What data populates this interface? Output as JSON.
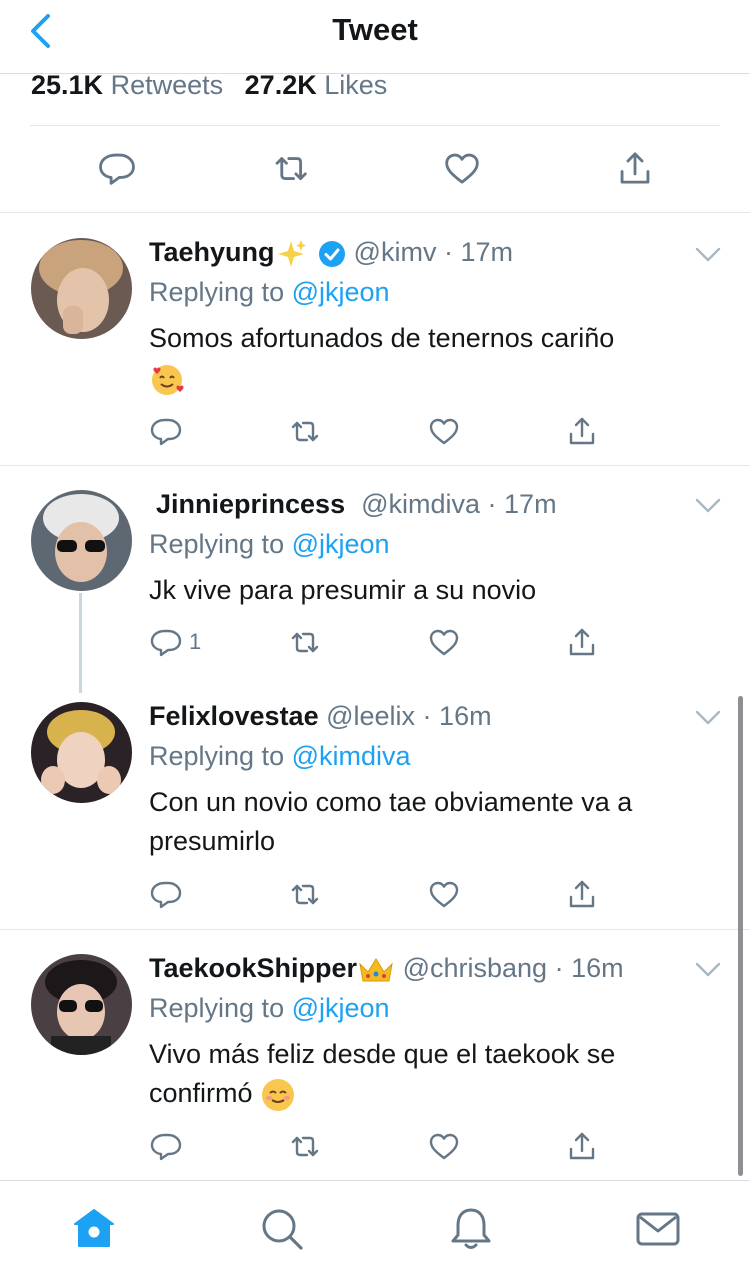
{
  "header": {
    "title": "Tweet"
  },
  "stats": {
    "retweets_count": "25.1K",
    "retweets_label": "Retweets",
    "likes_count": "27.2K",
    "likes_label": "Likes"
  },
  "colors": {
    "accent": "#1da1f2",
    "secondary_text": "#657786",
    "divider": "#e1e8ed"
  },
  "tweets": [
    {
      "name": "Taehyung",
      "name_emoji": "sparkles",
      "verified": true,
      "handle": "@kimv",
      "time": "17m",
      "replying_prefix": "Replying to",
      "replying_to": "@jkjeon",
      "text": "Somos afortunados de tenernos cariño",
      "text_emoji": "smiling-face-with-hearts"
    },
    {
      "name": "Jinnieprincess",
      "handle": "@kimdiva",
      "time": "17m",
      "replying_prefix": "Replying to",
      "replying_to": "@jkjeon",
      "text": "Jk vive para presumir a su novio",
      "reply_count": "1"
    },
    {
      "name": "Felixlovestae",
      "handle": "@leelix",
      "time": "16m",
      "replying_prefix": "Replying to",
      "replying_to": "@kimdiva",
      "text": "Con un novio como tae obviamente va a presumirlo"
    },
    {
      "name": "TaekookShipper",
      "name_emoji": "crown",
      "handle": "@chrisbang",
      "time": "16m",
      "replying_prefix": "Replying to",
      "replying_to": "@jkjeon",
      "text": "Vivo más feliz desde que el taekook se confirmó",
      "text_emoji": "smiling-face"
    }
  ],
  "tabbar": {
    "active": "home",
    "tabs": [
      "home-icon",
      "search-icon",
      "notifications-icon",
      "messages-icon"
    ]
  }
}
